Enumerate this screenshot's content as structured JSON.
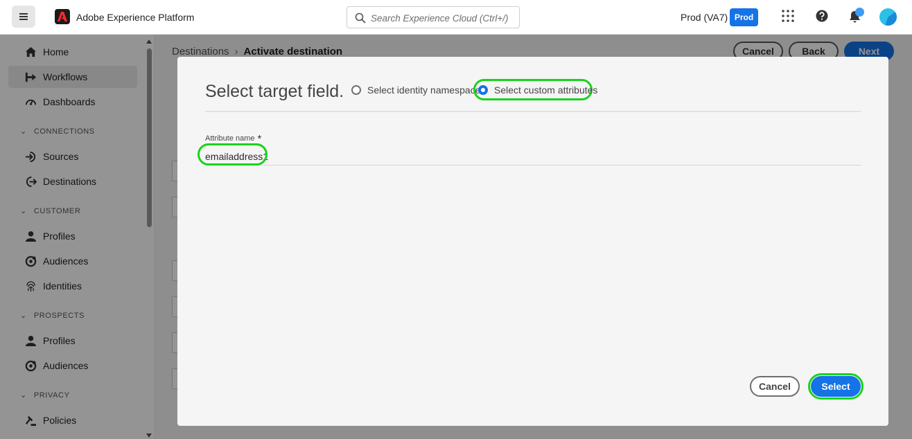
{
  "header": {
    "app_title": "Adobe Experience Platform",
    "search_placeholder": "Search Experience Cloud (Ctrl+/)",
    "org_name": "Prod (VA7)",
    "sandbox_badge": "Prod"
  },
  "sidebar": {
    "items": [
      {
        "label": "Home",
        "icon": "home-icon"
      },
      {
        "label": "Workflows",
        "icon": "workflows-icon",
        "active": true
      },
      {
        "label": "Dashboards",
        "icon": "dashboards-icon"
      }
    ],
    "sections": [
      {
        "title": "CONNECTIONS",
        "items": [
          {
            "label": "Sources",
            "icon": "sources-icon"
          },
          {
            "label": "Destinations",
            "icon": "destinations-icon"
          }
        ]
      },
      {
        "title": "CUSTOMER",
        "items": [
          {
            "label": "Profiles",
            "icon": "profiles-icon"
          },
          {
            "label": "Audiences",
            "icon": "audiences-icon"
          },
          {
            "label": "Identities",
            "icon": "identities-icon"
          }
        ]
      },
      {
        "title": "PROSPECTS",
        "items": [
          {
            "label": "Profiles",
            "icon": "profiles-icon"
          },
          {
            "label": "Audiences",
            "icon": "audiences-icon"
          }
        ]
      },
      {
        "title": "PRIVACY",
        "items": [
          {
            "label": "Policies",
            "icon": "policies-icon"
          }
        ]
      }
    ]
  },
  "page": {
    "breadcrumb": [
      "Destinations",
      "Activate destination"
    ],
    "buttons": {
      "cancel": "Cancel",
      "back": "Back",
      "next": "Next"
    }
  },
  "dialog": {
    "title": "Select target field.",
    "options": [
      {
        "label": "Select identity namespace",
        "checked": false
      },
      {
        "label": "Select custom attributes",
        "checked": true
      }
    ],
    "field_label": "Attribute name",
    "field_required": "*",
    "field_value": "emailaddress1",
    "cancel_label": "Cancel",
    "select_label": "Select"
  },
  "colors": {
    "accent": "#1473e6",
    "highlight": "#18d31c"
  }
}
